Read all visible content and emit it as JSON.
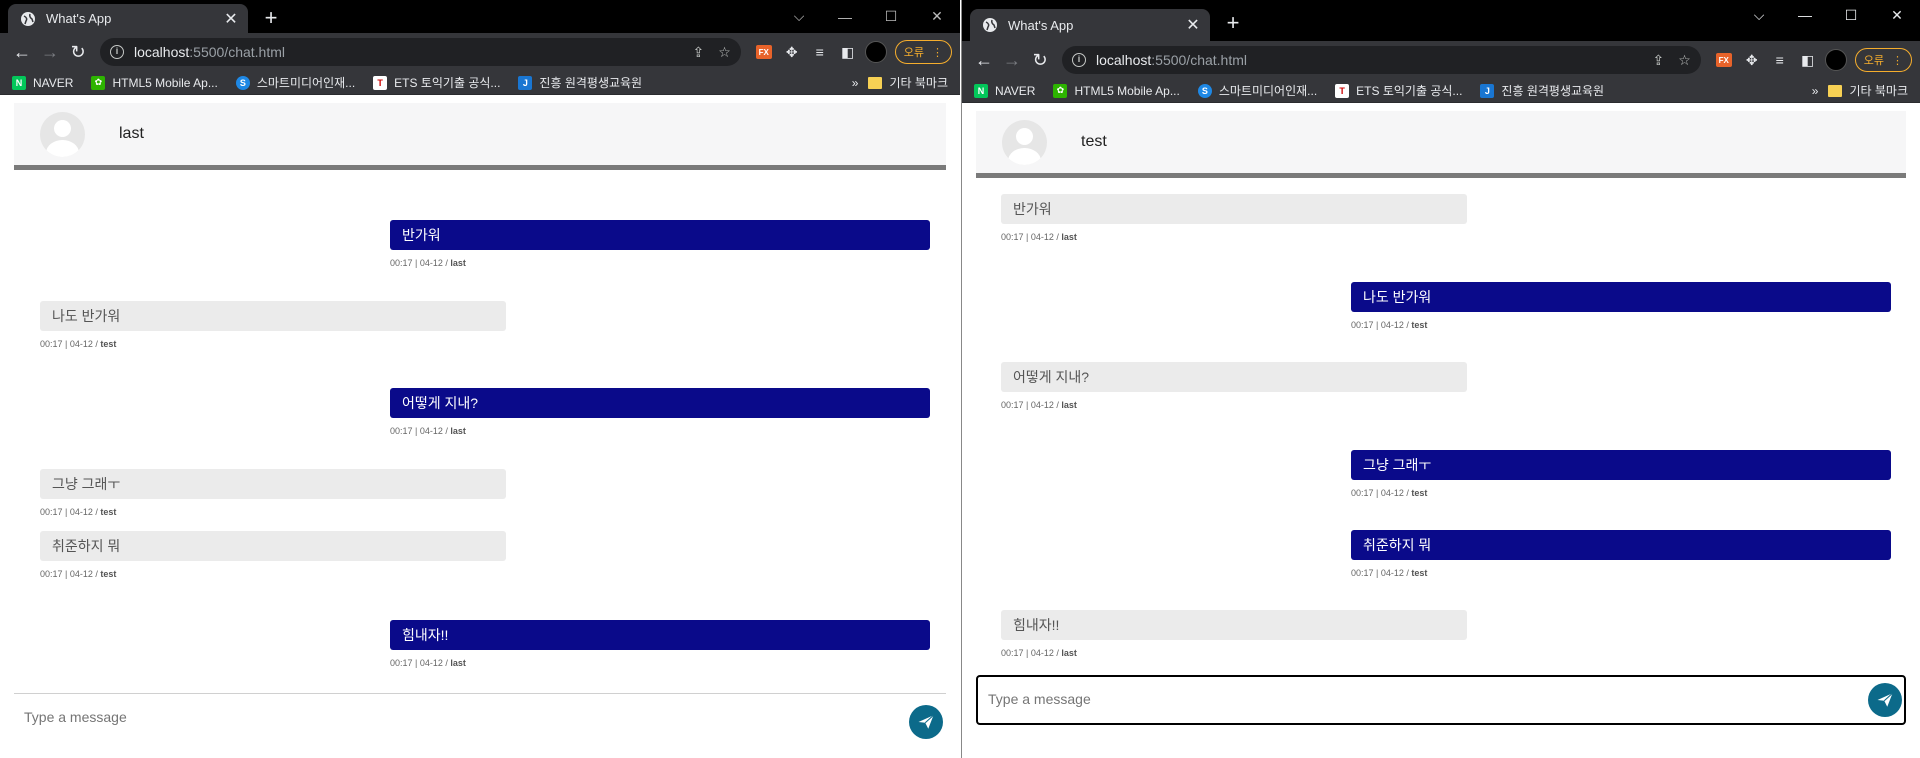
{
  "browser": {
    "tab_title": "What's App",
    "url_host": "localhost",
    "url_path": ":5500/chat.html",
    "error_label": "오류",
    "bookmarks": [
      "NAVER",
      "HTML5 Mobile Ap...",
      "스마트미디어인재...",
      "ETS 토익기출 공식...",
      "진흥 원격평생교육원"
    ],
    "other_bookmarks": "기타 북마크",
    "fx_label": "FX"
  },
  "left_window": {
    "contact_name": "last",
    "messages": [
      {
        "dir": "out",
        "text": "반가워",
        "time": "00:17 | 04-12 / ",
        "sender": "last"
      },
      {
        "dir": "in",
        "text": "나도 반가워",
        "time": "00:17 | 04-12 / ",
        "sender": "test"
      },
      {
        "dir": "out",
        "text": "어떻게 지내?",
        "time": "00:17 | 04-12 / ",
        "sender": "last"
      },
      {
        "dir": "in",
        "text": "그냥 그래ㅜ",
        "time": "00:17 | 04-12 / ",
        "sender": "test"
      },
      {
        "dir": "in",
        "text": "취준하지 뭐",
        "time": "00:17 | 04-12 / ",
        "sender": "test"
      },
      {
        "dir": "out",
        "text": "힘내자!!",
        "time": "00:17 | 04-12 / ",
        "sender": "last"
      }
    ],
    "input_placeholder": "Type a message"
  },
  "right_window": {
    "contact_name": "test",
    "messages": [
      {
        "dir": "in",
        "text": "반가워",
        "time": "00:17 | 04-12 / ",
        "sender": "last"
      },
      {
        "dir": "out",
        "text": "나도 반가워",
        "time": "00:17 | 04-12 / ",
        "sender": "test"
      },
      {
        "dir": "in",
        "text": "어떻게 지내?",
        "time": "00:17 | 04-12 / ",
        "sender": "last"
      },
      {
        "dir": "out",
        "text": "그냥 그래ㅜ",
        "time": "00:17 | 04-12 / ",
        "sender": "test"
      },
      {
        "dir": "out",
        "text": "취준하지 뭐",
        "time": "00:17 | 04-12 / ",
        "sender": "test"
      },
      {
        "dir": "in",
        "text": "힘내자!!",
        "time": "00:17 | 04-12 / ",
        "sender": "last"
      }
    ],
    "input_placeholder": "Type a message"
  }
}
